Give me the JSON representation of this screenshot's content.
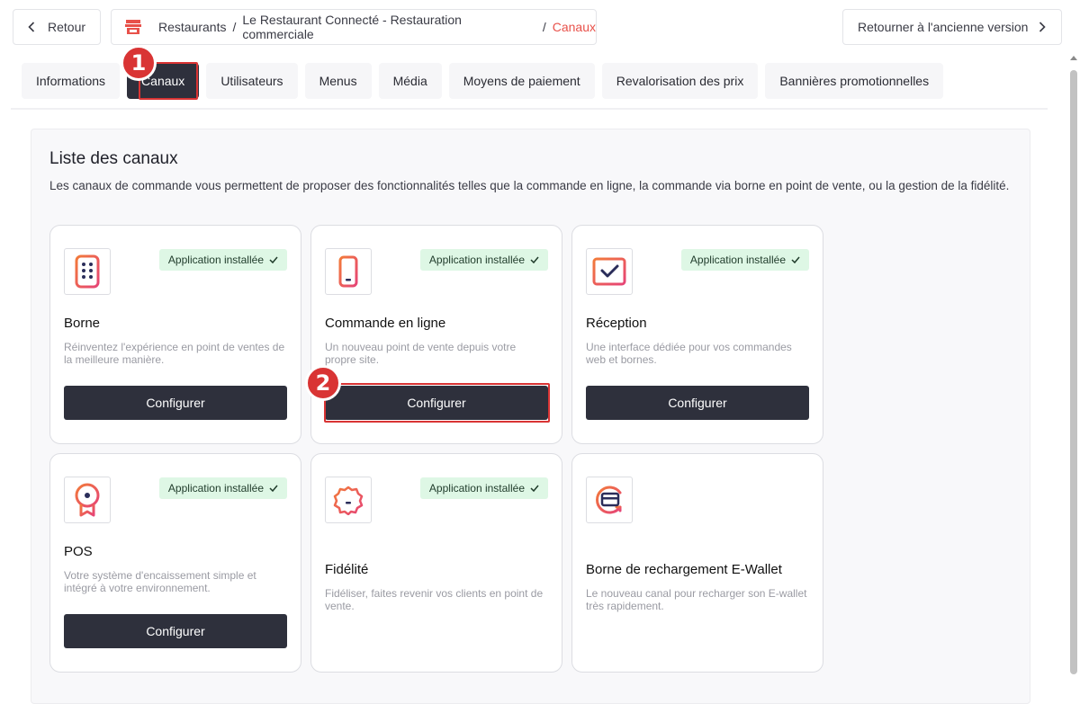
{
  "topbar": {
    "back_label": "Retour",
    "breadcrumb": [
      "Restaurants",
      "Le Restaurant Connecté - Restauration commerciale",
      "Canaux"
    ],
    "breadcrumb_sep": "/",
    "old_version_label": "Retourner à l'ancienne version"
  },
  "tabs": [
    "Informations",
    "Canaux",
    "Utilisateurs",
    "Menus",
    "Média",
    "Moyens de paiement",
    "Revalorisation des prix",
    "Bannières promotionnelles"
  ],
  "active_tab": "Canaux",
  "steps": [
    "1",
    "2"
  ],
  "panel": {
    "title": "Liste des canaux",
    "description": "Les canaux de commande vous permettent de proposer des fonctionnalités telles que la commande en ligne, la commande via borne en point de vente, ou la gestion de la fidélité."
  },
  "cards": [
    {
      "title": "Borne",
      "description": "Réinventez l'expérience en point de ventes de la meilleure manière.",
      "status": "Application installée",
      "button": "Configurer",
      "icon": "kiosk-icon"
    },
    {
      "title": "Commande en ligne",
      "description": "Un nouveau point de vente depuis votre propre site.",
      "status": "Application installée",
      "button": "Configurer",
      "icon": "phone-icon"
    },
    {
      "title": "Réception",
      "description": "Une interface dédiée pour vos commandes web et bornes.",
      "status": "Application installée",
      "button": "Configurer",
      "icon": "reception-icon"
    },
    {
      "title": "POS",
      "description": "Votre système d'encaissement simple et intégré à votre environnement.",
      "status": "Application installée",
      "button": "Configurer",
      "icon": "pos-icon"
    },
    {
      "title": "Fidélité",
      "description": "Fidéliser, faites revenir vos clients en point de vente.",
      "status": "Application installée",
      "icon": "loyalty-icon"
    },
    {
      "title": "Borne de rechargement E-Wallet",
      "description": "Le nouveau canal pour recharger son E-wallet très rapidement.",
      "icon": "ewallet-icon"
    }
  ],
  "colors": {
    "accent": "#e8514a",
    "dark": "#2e303c",
    "highlight": "#d93434",
    "status_bg": "#def7e5"
  }
}
